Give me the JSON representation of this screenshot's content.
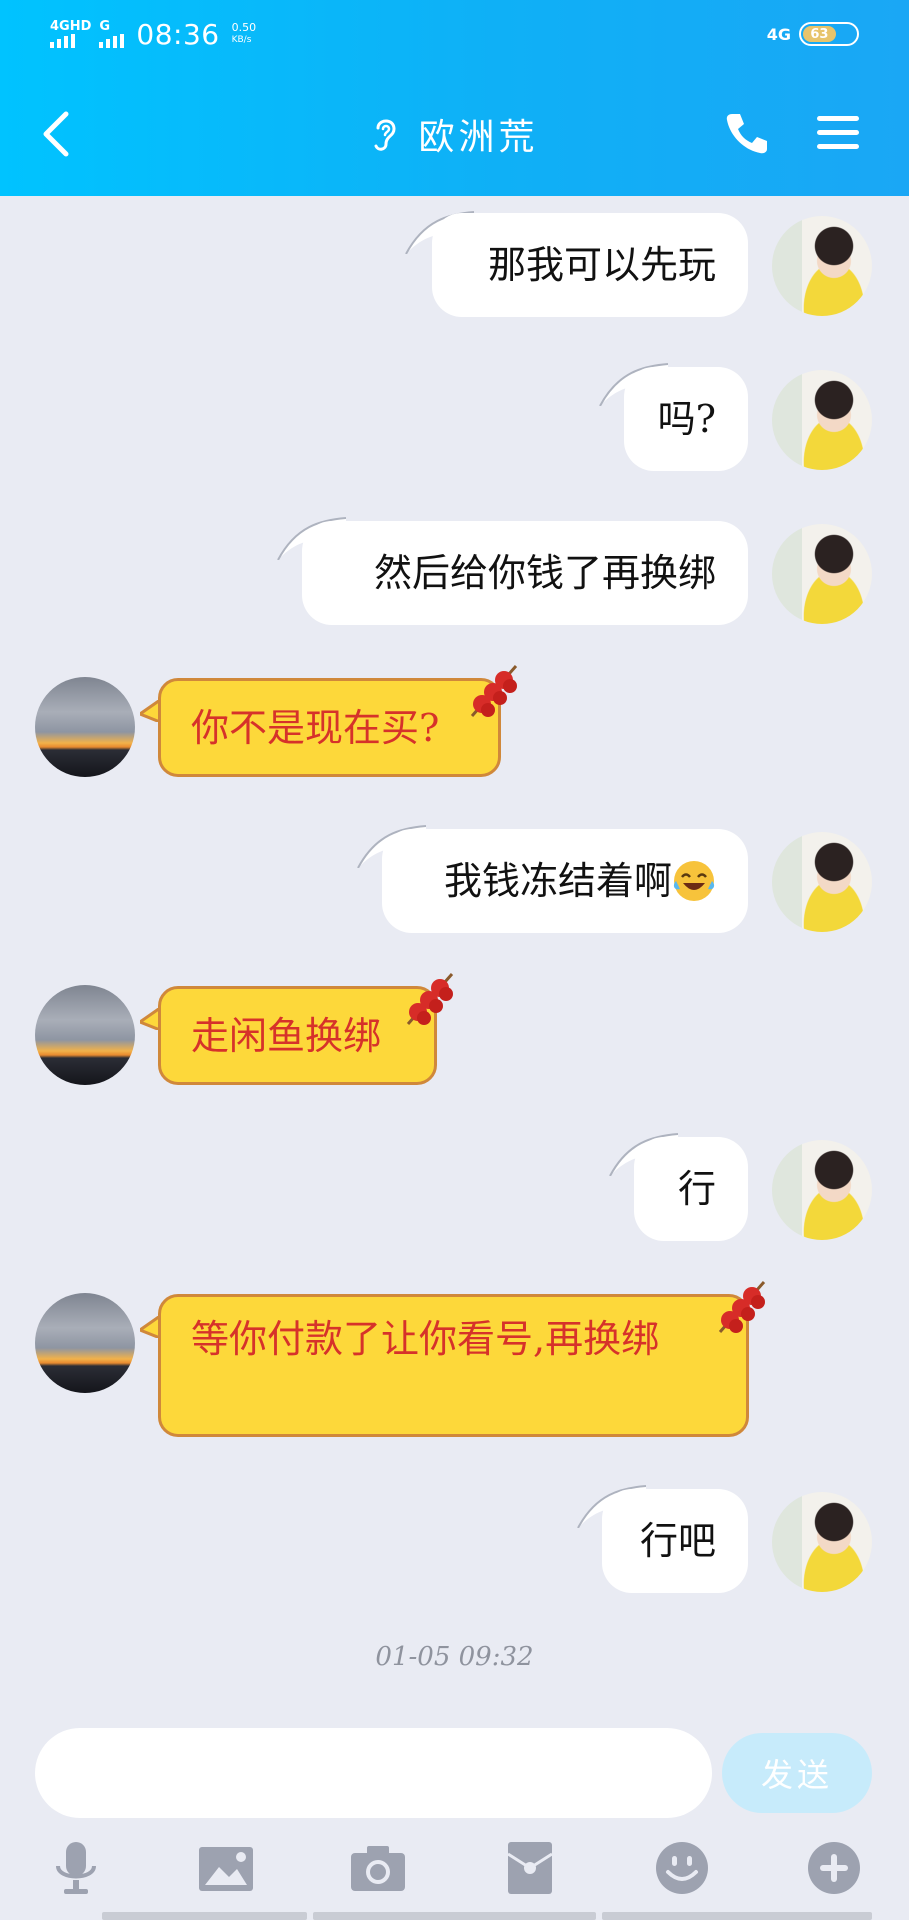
{
  "status_bar": {
    "sim1": "4GHD",
    "sim2": "G",
    "time": "08:36",
    "speed": "0.50",
    "speed_unit": "KB/s",
    "network": "4G",
    "battery": "63",
    "battery_level": 0.63
  },
  "header": {
    "title": "欧洲荒",
    "icons": [
      "back-icon",
      "ear-icon",
      "phone-icon",
      "menu-icon"
    ]
  },
  "messages": [
    {
      "side": "out",
      "text": "那我可以先玩"
    },
    {
      "side": "out",
      "text": "吗?"
    },
    {
      "side": "out",
      "text": "然后给你钱了再换绑"
    },
    {
      "side": "in",
      "text": "你不是现在买?"
    },
    {
      "side": "out",
      "text": "我钱冻结着啊",
      "emoji": "laughing-tears-emoji"
    },
    {
      "side": "in",
      "text": "走闲鱼换绑"
    },
    {
      "side": "out",
      "text": "行"
    },
    {
      "side": "in",
      "text": "等你付款了让你看号,再换绑"
    },
    {
      "side": "out",
      "text": "行吧"
    }
  ],
  "timestamp": "01-05 09:32",
  "composer": {
    "placeholder": "",
    "send_label": "发送"
  },
  "toolbar": [
    "microphone-icon",
    "image-icon",
    "camera-icon",
    "red-packet-icon",
    "emoji-icon",
    "plus-icon"
  ],
  "colors": {
    "header_start": "#00c3ff",
    "header_end": "#1aa7f5",
    "background": "#e9ebf3",
    "incoming_bubble": "#fdd83a",
    "incoming_text": "#d6322a",
    "send_button": "#c7ebfb"
  }
}
